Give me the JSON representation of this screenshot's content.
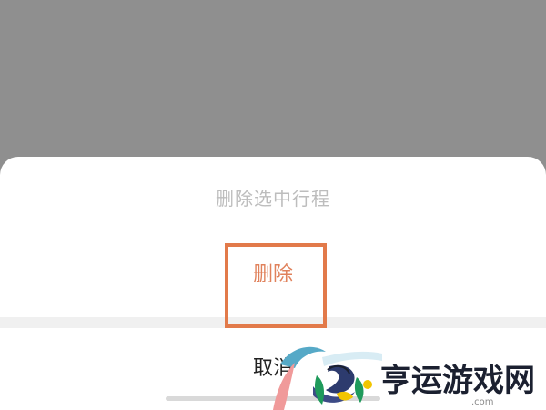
{
  "action_sheet": {
    "title": "删除选中行程",
    "delete_label": "删除",
    "cancel_label": "取消"
  },
  "watermark": {
    "brand": "亨运游戏网",
    "domain": ".com"
  },
  "colors": {
    "overlay": "#8f8f8f",
    "delete": "#e0815b",
    "highlight": "#e27a4a",
    "title": "#bdbdbd"
  }
}
